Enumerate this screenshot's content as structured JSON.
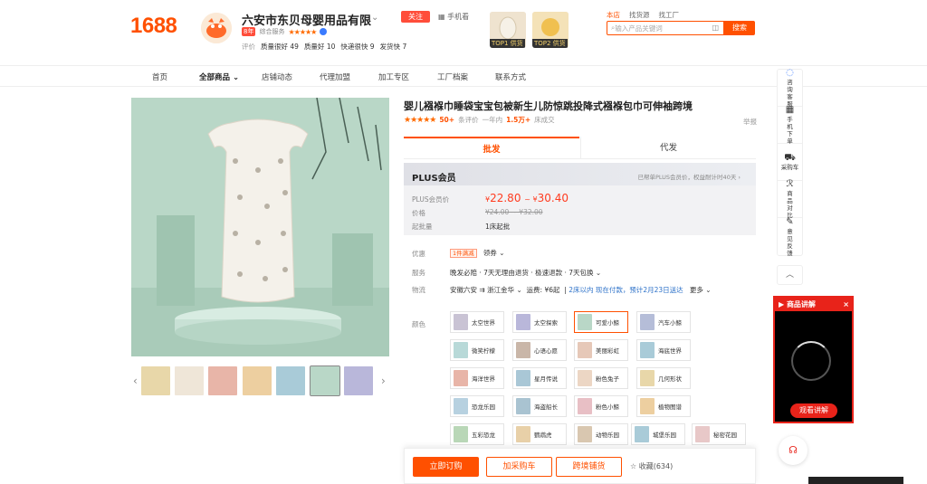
{
  "header": {
    "logo": "1688",
    "shop_name": "六安市东贝母婴用品有限",
    "follow_label": "关注",
    "mobile_label": "手机看",
    "badge_label": "8年",
    "badge_type": "综合服务",
    "scores": [
      {
        "label": "评价",
        "value": ""
      },
      {
        "label": "质量很好",
        "value": "49"
      },
      {
        "label": "质量好",
        "value": "10"
      },
      {
        "label": "快递很快",
        "value": "9"
      },
      {
        "label": "发货快",
        "value": "7"
      }
    ],
    "top_tags": [
      "TOP1 供货",
      "TOP2 供货"
    ],
    "search_tabs": [
      "本店",
      "找货源",
      "找工厂"
    ],
    "search_placeholder": "输入产品关键词",
    "search_button": "搜索"
  },
  "nav": {
    "items": [
      "首页",
      "全部商品",
      "店铺动态",
      "代理加盟",
      "加工专区",
      "工厂档案",
      "联系方式"
    ]
  },
  "product": {
    "title": "婴儿襁褓巾睡袋宝宝包被新生儿防惊跳投降式襁褓包巾可伸袖跨境",
    "rating_stars": "★★★★★",
    "reviews_count": "50+",
    "reviews_label": "条评价",
    "sales_prefix": "一年内",
    "sales_count": "1.5万+",
    "sales_suffix": "床成交",
    "report_label": "举报",
    "tabs": [
      "批发",
      "代发"
    ],
    "plus": {
      "title": "PLUS会员",
      "note": "已帮单PLUS会员价，权益耐计时40天 ›",
      "price_label": "PLUS会员价",
      "price_low": "22.80",
      "price_high": "30.40",
      "currency": "¥",
      "orig_label": "价格",
      "orig_price": "¥24.00 ~ ¥32.00",
      "moq_label": "起批量",
      "moq_value": "1床起批"
    },
    "promo_label": "优惠",
    "promo_tag": "1件满减",
    "promo_more": "领券",
    "service_label": "服务",
    "service_value": "晚发必赔 · 7天无理由退货 · 极速退款 · 7天包换",
    "logistics_label": "物流",
    "logistics_from": "安徽六安",
    "logistics_to": "浙江金华",
    "logistics_fee": "运费: ¥6起",
    "logistics_eta": "2床以内 现在付款，预计2月23日送达",
    "logistics_more": "更多",
    "color_label": "颜色",
    "colors": [
      "太空世界",
      "太空探索",
      "可爱小鲸",
      "汽车小鲸",
      "微笑柠檬",
      "心语心愿",
      "美丽彩虹",
      "海底世界",
      "海洋世界",
      "星月传说",
      "粉色兔子",
      "几何形状",
      "恐龙乐园",
      "海盗船长",
      "粉色小鲸",
      "植物图谱",
      "五彩恐龙",
      "鹦鹉虎",
      "动物乐园",
      "城堡乐园",
      "秘密花园"
    ],
    "selected_color": "可爱小鲸",
    "buy_now": "立即订购",
    "add_cart": "加采购车",
    "cross_border": "跨境铺货",
    "favorite": "收藏(634)"
  },
  "sidebar": {
    "items": [
      {
        "icon": "chat-icon",
        "label": "咨询客服"
      },
      {
        "icon": "qr-icon",
        "label": "手机下单"
      },
      {
        "icon": "cart-icon",
        "label": "采购车"
      },
      {
        "icon": "compare-icon",
        "label": "商品对比"
      },
      {
        "icon": "feedback-icon",
        "label": "意见反馈"
      }
    ],
    "up_label": "^"
  },
  "video": {
    "title": "商品讲解",
    "watch_label": "观看讲解",
    "close": "×"
  },
  "colors": {
    "accent": "#ff5000",
    "price_red": "#ff3b1f",
    "video_red": "#e8231a"
  }
}
